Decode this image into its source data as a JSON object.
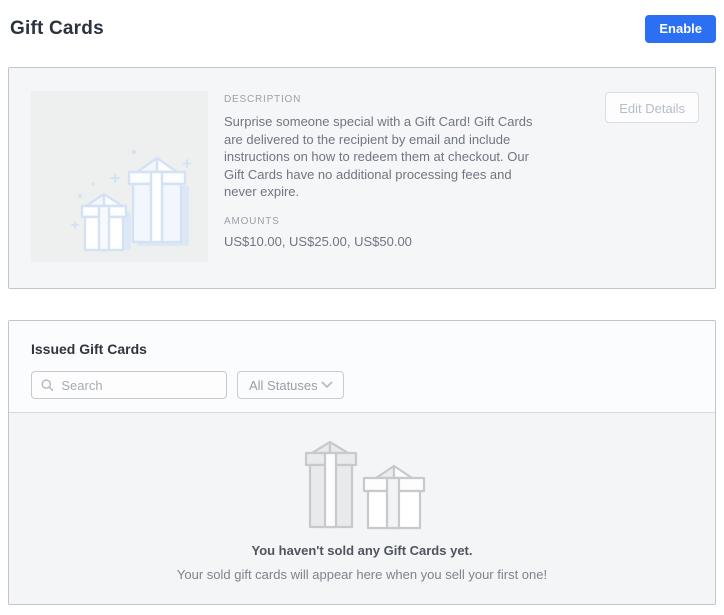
{
  "page": {
    "title": "Gift Cards"
  },
  "header": {
    "enable_label": "Enable"
  },
  "settings": {
    "description_label": "DESCRIPTION",
    "description_text": "Surprise someone special with a Gift Card! Gift Cards are delivered to the recipient by email and include instructions on how to redeem them at checkout. Our Gift Cards have no additional processing fees and never expire.",
    "amounts_label": "AMOUNTS",
    "amounts_value": "US$10.00, US$25.00, US$50.00",
    "edit_button_label": "Edit Details"
  },
  "issued": {
    "title": "Issued Gift Cards",
    "search_placeholder": "Search",
    "status_filter_value": "All Statuses",
    "empty_title": "You haven't sold any Gift Cards yet.",
    "empty_subtitle": "Your sold gift cards will appear here when you sell your first one!"
  },
  "icons": {
    "search": "search-icon",
    "chevron": "chevron-down-icon",
    "gift_blue": "gift-boxes-illustration-blue",
    "gift_gray": "gift-boxes-illustration-gray"
  },
  "colors": {
    "accent_blue": "#2b6ff2",
    "card_background": "#f5f6f8",
    "card_border": "#c2c6cb",
    "muted_text": "#6f7680",
    "label_text": "#9ba1a9",
    "disabled_button_text": "#b8bec6"
  }
}
